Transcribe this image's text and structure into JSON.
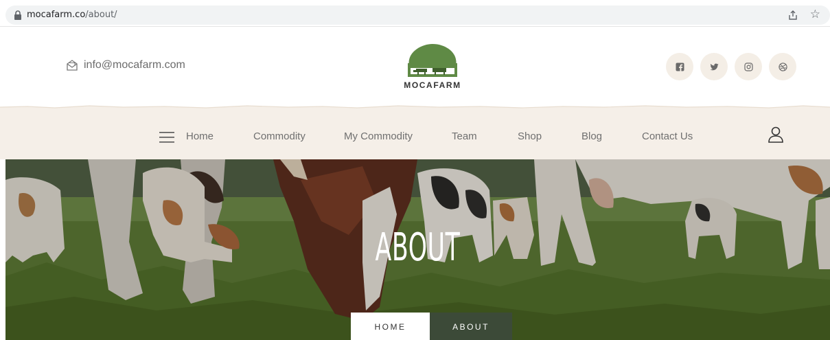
{
  "browser": {
    "url_host": "mocafarm.co",
    "url_path": "/about/"
  },
  "header": {
    "email": "info@mocafarm.com",
    "logo_text": "MOCAFARM",
    "socials": [
      "facebook-icon",
      "twitter-icon",
      "instagram-icon",
      "dribbble-icon"
    ]
  },
  "nav": {
    "items": [
      "Home",
      "Commodity",
      "My Commodity",
      "Team",
      "Shop",
      "Blog",
      "Contact Us"
    ]
  },
  "hero": {
    "title": "ABOUT",
    "breadcrumb": [
      "HOME",
      "ABOUT"
    ]
  },
  "colors": {
    "brand_green": "#5f8a45",
    "nav_bg": "#f5efe8",
    "social_bg": "#f4eee6",
    "breadcrumb_active": "#3c4a38"
  }
}
